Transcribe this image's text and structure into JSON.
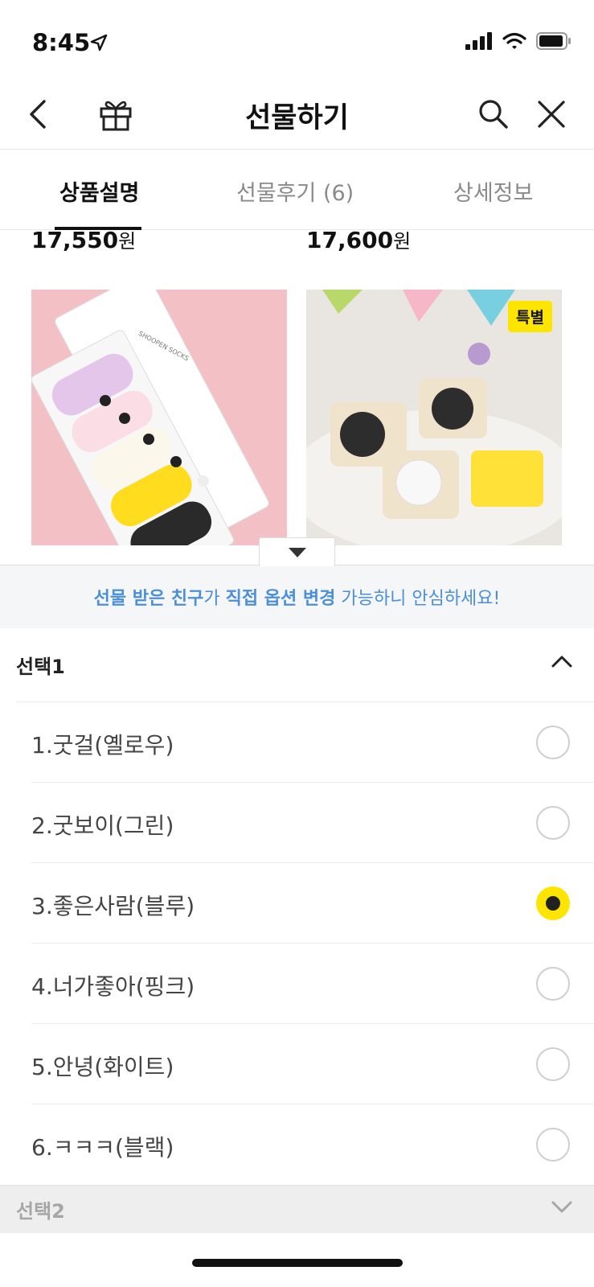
{
  "status_bar": {
    "time": "8:45"
  },
  "header": {
    "title": "선물하기"
  },
  "tabs": [
    {
      "label": "상품설명",
      "active": true
    },
    {
      "label": "선물후기 (6)",
      "active": false
    },
    {
      "label": "상세정보",
      "active": false
    }
  ],
  "products": [
    {
      "price": "17,550",
      "currency": "원",
      "image_text": "SHOOPEN SOCKS"
    },
    {
      "price": "17,600",
      "currency": "원",
      "badge": "특별"
    }
  ],
  "notice": {
    "part1": "선물 받은 친구",
    "part2": "가 ",
    "part3": "직접 옵션 변경",
    "part4": " 가능하니 안심하세요!"
  },
  "option_groups": [
    {
      "title": "선택1",
      "expanded": true,
      "options": [
        {
          "label": "1.굿걸(옐로우)",
          "selected": false
        },
        {
          "label": "2.굿보이(그린)",
          "selected": false
        },
        {
          "label": "3.좋은사람(블루)",
          "selected": true
        },
        {
          "label": "4.너가좋아(핑크)",
          "selected": false
        },
        {
          "label": "5.안녕(화이트)",
          "selected": false
        },
        {
          "label": "6.ㅋㅋㅋ(블랙)",
          "selected": false
        }
      ]
    },
    {
      "title": "선택2",
      "expanded": false
    }
  ],
  "colors": {
    "accent_yellow": "#fee500",
    "notice_blue": "#4a8fd8"
  }
}
